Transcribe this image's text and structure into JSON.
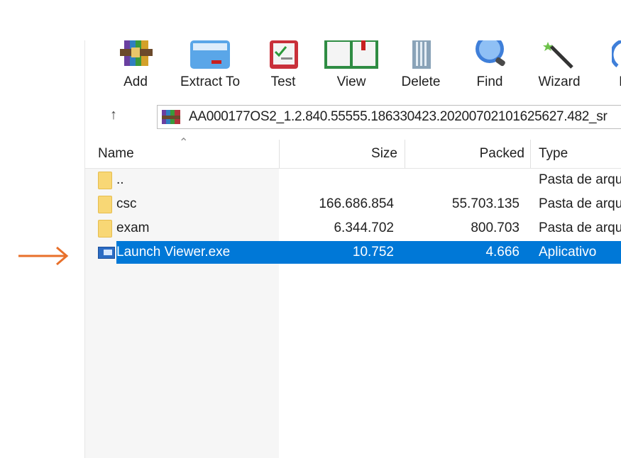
{
  "toolbar": {
    "buttons": [
      {
        "label": "Add",
        "icon": "winrar-add-icon"
      },
      {
        "label": "Extract To",
        "icon": "extract-folder-icon"
      },
      {
        "label": "Test",
        "icon": "test-checklist-icon"
      },
      {
        "label": "View",
        "icon": "view-book-icon"
      },
      {
        "label": "Delete",
        "icon": "trash-can-icon"
      },
      {
        "label": "Find",
        "icon": "magnifier-icon"
      },
      {
        "label": "Wizard",
        "icon": "magic-wand-icon"
      },
      {
        "label": "I",
        "icon": "info-icon"
      }
    ]
  },
  "address": {
    "path": "AA000177OS2_1.2.840.55555.186330423.20200702101625627.482_sr",
    "up_icon": "up-arrow-icon"
  },
  "columns": {
    "name": "Name",
    "size": "Size",
    "packed": "Packed",
    "type": "Type"
  },
  "files": [
    {
      "name": "..",
      "size": "",
      "packed": "",
      "type": "Pasta de arqu",
      "icon": "folder-icon"
    },
    {
      "name": "csc",
      "size": "166.686.854",
      "packed": "55.703.135",
      "type": "Pasta de arqu",
      "icon": "folder-icon"
    },
    {
      "name": "exam",
      "size": "6.344.702",
      "packed": "800.703",
      "type": "Pasta de arqu",
      "icon": "folder-icon"
    },
    {
      "name": "Launch Viewer.exe",
      "size": "10.752",
      "packed": "4.666",
      "type": "Aplicativo",
      "icon": "exe-icon",
      "selected": true
    }
  ],
  "annotation": {
    "icon": "orange-arrow-icon",
    "color": "#e8702a"
  },
  "colors": {
    "selection": "#0078d7"
  }
}
